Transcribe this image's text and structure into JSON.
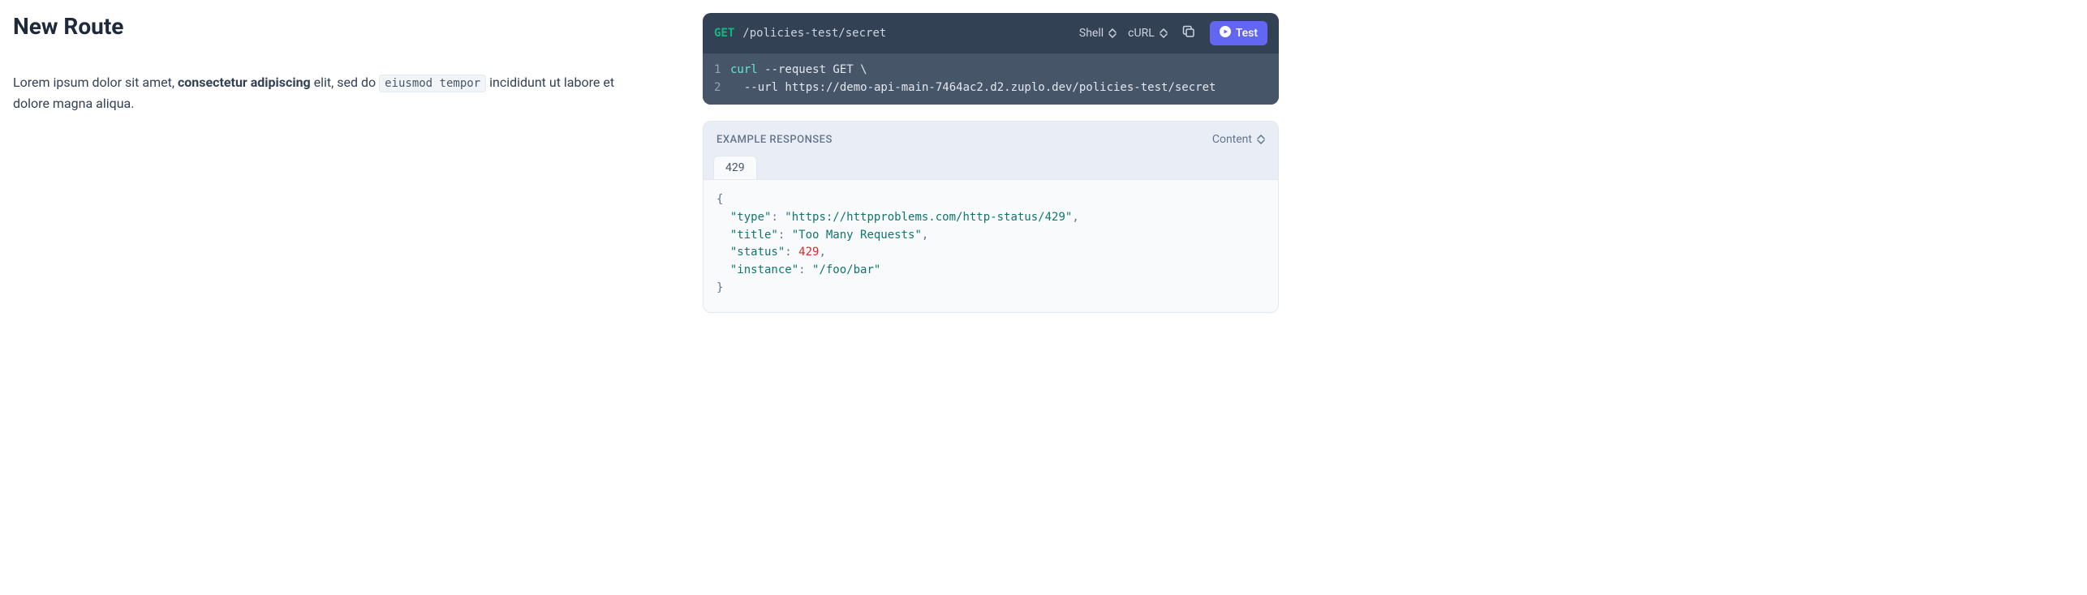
{
  "page": {
    "title": "New Route",
    "description_pre": "Lorem ipsum dolor sit amet, ",
    "description_bold": "consectetur adipiscing",
    "description_mid": " elit, sed do ",
    "description_code": "eiusmod tempor",
    "description_post": " incididunt ut labore et dolore magna aliqua."
  },
  "request": {
    "method": "GET",
    "path": "/policies-test/secret",
    "language_selector": "Shell",
    "tool_selector": "cURL",
    "test_button": "Test",
    "code": {
      "line1_cmd": "curl",
      "line1_rest": " --request GET \\",
      "line2": "  --url https://demo-api-main-7464ac2.d2.zuplo.dev/policies-test/secret"
    }
  },
  "response": {
    "section_title": "EXAMPLE RESPONSES",
    "content_selector": "Content",
    "tab_label": "429",
    "body": {
      "type_key": "\"type\"",
      "type_val": "\"https://httpproblems.com/http-status/429\"",
      "title_key": "\"title\"",
      "title_val": "\"Too Many Requests\"",
      "status_key": "\"status\"",
      "status_val": "429",
      "instance_key": "\"instance\"",
      "instance_val": "\"/foo/bar\""
    }
  }
}
